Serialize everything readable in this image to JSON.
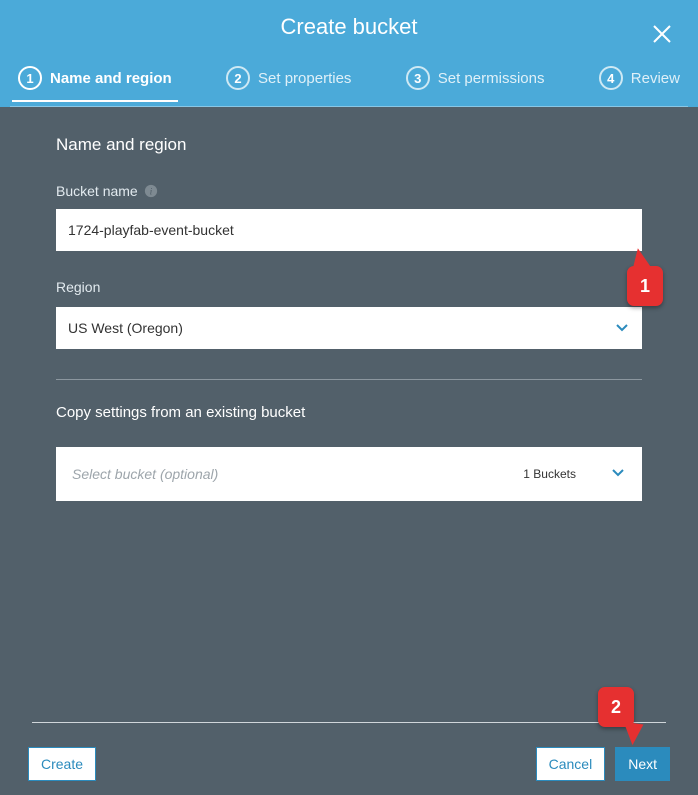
{
  "dialog": {
    "title": "Create bucket"
  },
  "steps": [
    {
      "num": "1",
      "label": "Name and region",
      "active": true
    },
    {
      "num": "2",
      "label": "Set properties",
      "active": false
    },
    {
      "num": "3",
      "label": "Set permissions",
      "active": false
    },
    {
      "num": "4",
      "label": "Review",
      "active": false
    }
  ],
  "form": {
    "section_title": "Name and region",
    "bucket_name_label": "Bucket name",
    "bucket_name_value": "1724-playfab-event-bucket",
    "region_label": "Region",
    "region_value": "US West (Oregon)",
    "copy_title": "Copy settings from an existing bucket",
    "copy_placeholder": "Select bucket (optional)",
    "bucket_count": "1 Buckets"
  },
  "footer": {
    "create": "Create",
    "cancel": "Cancel",
    "next": "Next"
  },
  "annotations": {
    "a1": "1",
    "a2": "2"
  }
}
